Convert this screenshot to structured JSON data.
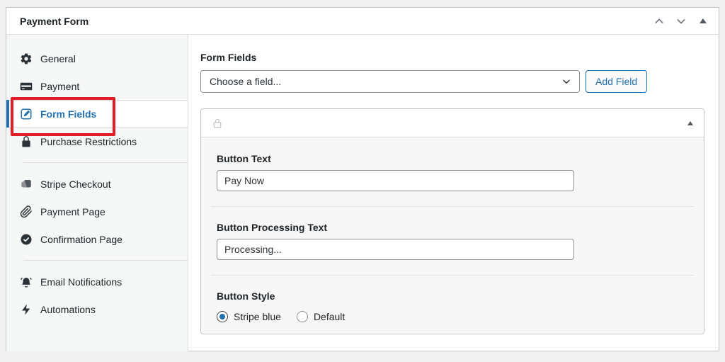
{
  "metabox": {
    "title": "Payment Form",
    "controls": {
      "move_up_icon": "chevron-up-icon",
      "move_down_icon": "chevron-down-icon",
      "toggle_icon": "collapse-triangle-icon"
    }
  },
  "sidebar": {
    "groups": [
      {
        "items": [
          {
            "icon": "gear-icon",
            "label": "General",
            "active": false
          },
          {
            "icon": "credit-card-icon",
            "label": "Payment",
            "active": false
          },
          {
            "icon": "edit-icon",
            "label": "Form Fields",
            "active": true
          },
          {
            "icon": "lock-icon",
            "label": "Purchase Restrictions",
            "active": false
          }
        ]
      },
      {
        "items": [
          {
            "icon": "stripe-checkout-icon",
            "label": "Stripe Checkout",
            "active": false
          },
          {
            "icon": "paperclip-icon",
            "label": "Payment Page",
            "active": false
          },
          {
            "icon": "check-circle-icon",
            "label": "Confirmation Page",
            "active": false
          }
        ]
      },
      {
        "items": [
          {
            "icon": "bell-icon",
            "label": "Email Notifications",
            "active": false
          },
          {
            "icon": "lightning-icon",
            "label": "Automations",
            "active": false
          }
        ]
      }
    ]
  },
  "main": {
    "section_label": "Form Fields",
    "field_picker": {
      "selected_value": "Choose a field...",
      "dropdown_icon": "chevron-down-icon",
      "add_button_label": "Add Field"
    },
    "panel": {
      "header_icon": "lock-icon",
      "toggle_icon": "collapse-triangle-icon",
      "fields": [
        {
          "label": "Button Text",
          "type": "text",
          "value": "Pay Now"
        },
        {
          "label": "Button Processing Text",
          "type": "text",
          "value": "Processing..."
        },
        {
          "label": "Button Style",
          "type": "radio",
          "options": [
            {
              "label": "Stripe blue",
              "selected": true
            },
            {
              "label": "Default",
              "selected": false
            }
          ]
        }
      ]
    }
  },
  "annotation": {
    "type": "highlight-box",
    "target": "Form Fields tab",
    "color": "#e21d25"
  },
  "colors": {
    "page_bg": "#f0f0f1",
    "box_border": "#c3c4c7",
    "sidebar_bg": "#f6f7f7",
    "accent_blue": "#2271b1",
    "panel_body_bg": "#f7f7f7",
    "annotation_red": "#e21d25",
    "text_dark": "#1d2327"
  }
}
